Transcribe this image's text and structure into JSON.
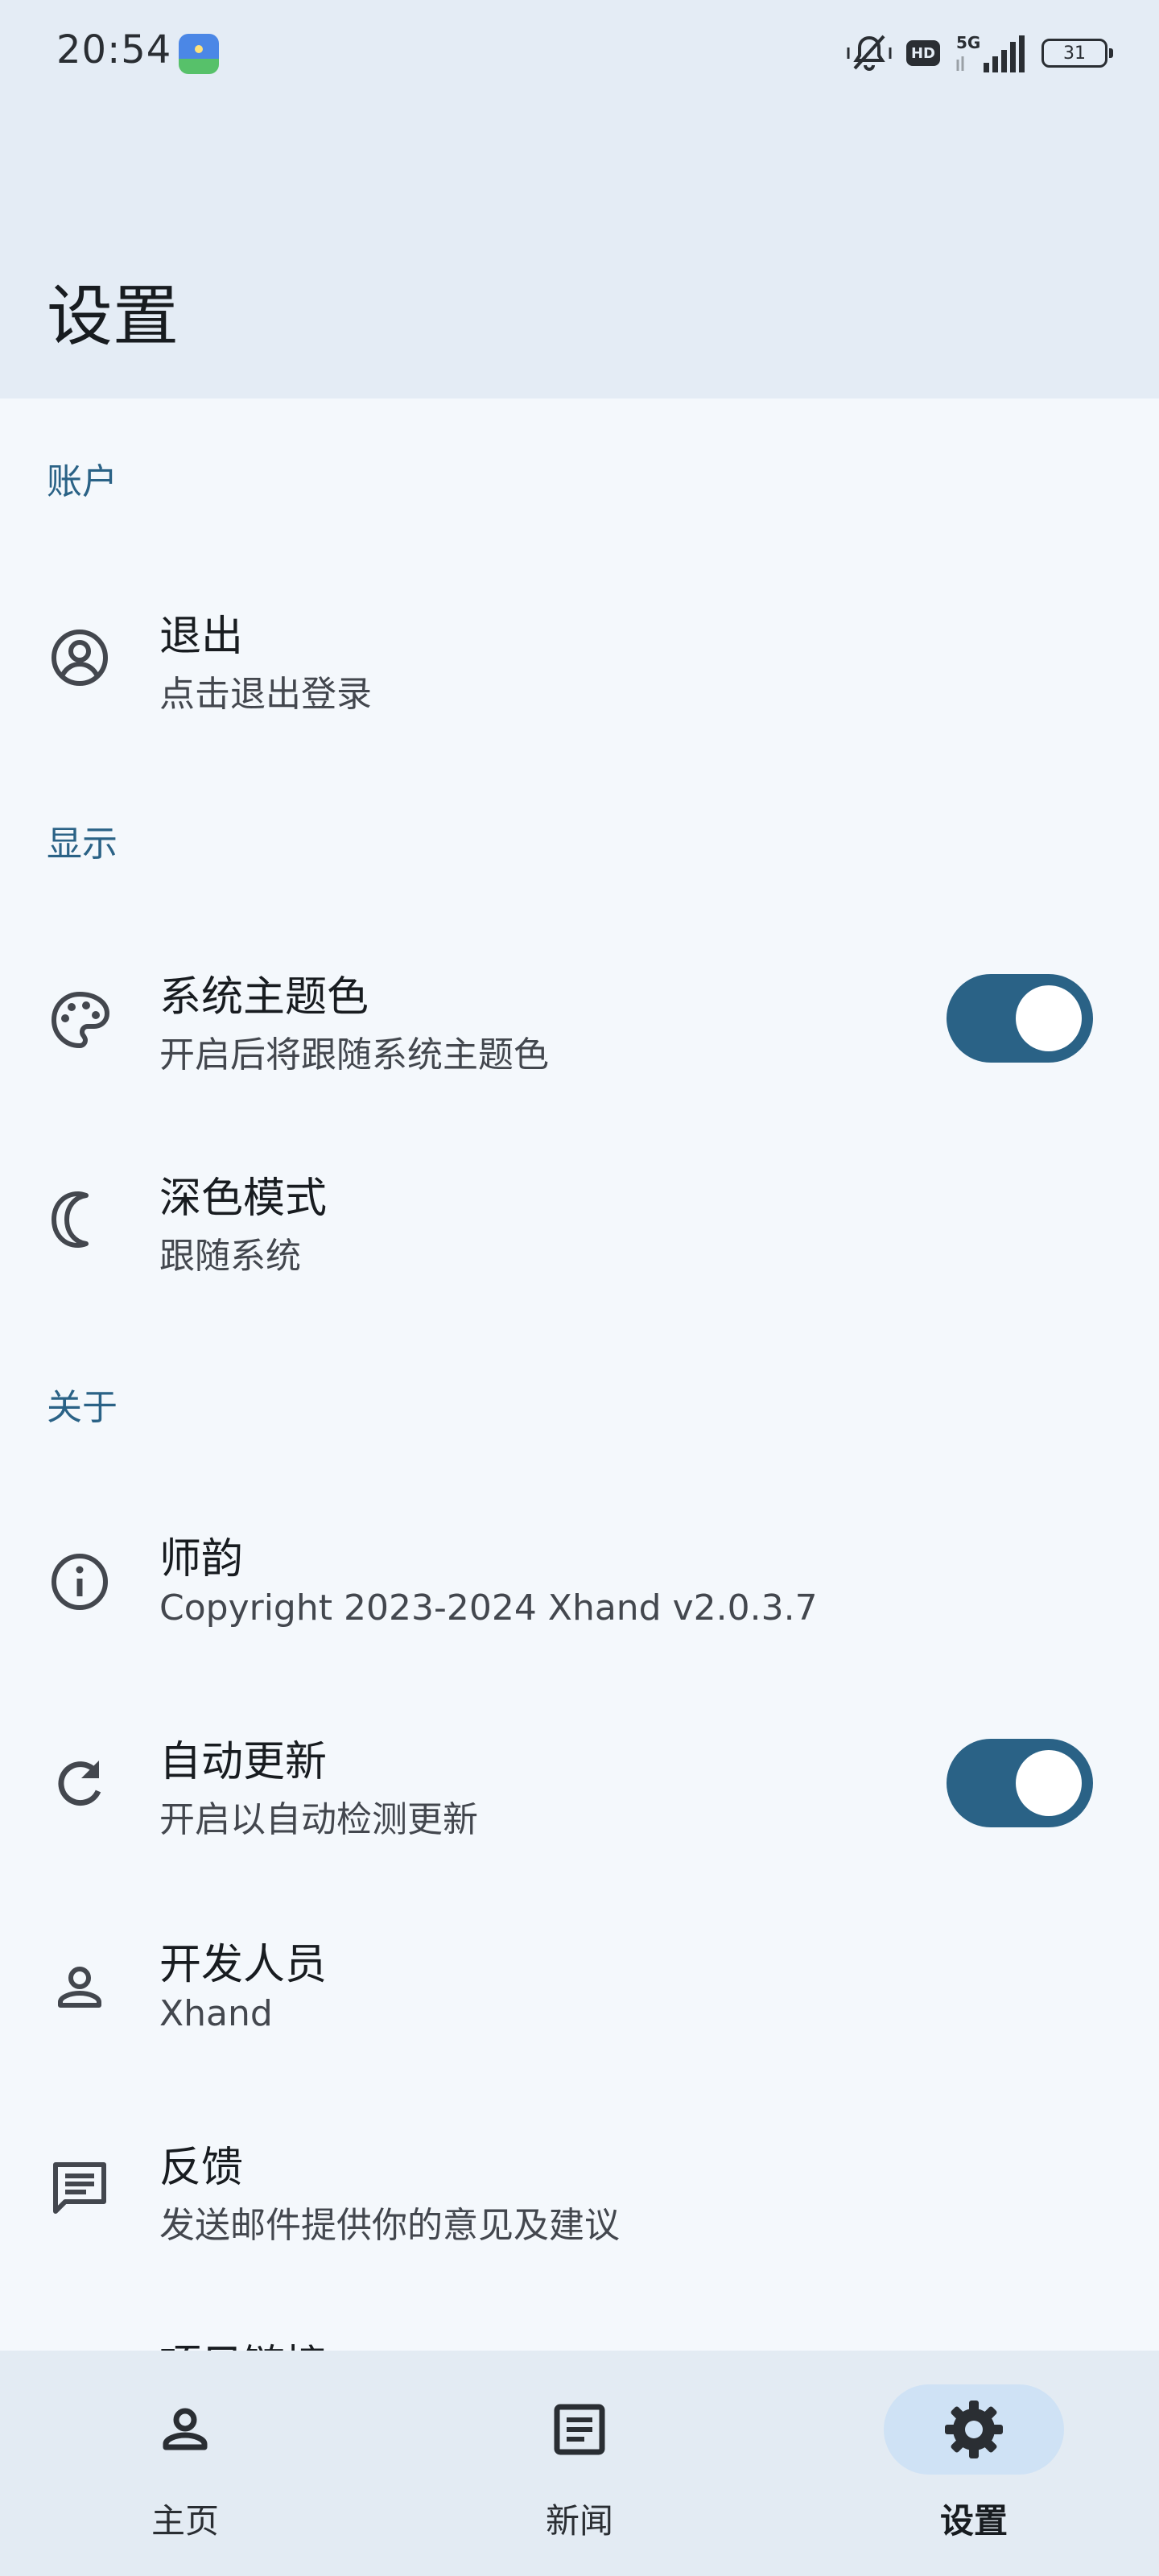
{
  "status_bar": {
    "time": "20:54",
    "hd_label": "HD",
    "network_label": "5G",
    "battery_level": "31"
  },
  "header": {
    "title": "设置"
  },
  "sections": {
    "account": "账户",
    "display": "显示",
    "about": "关于"
  },
  "rows": {
    "logout": {
      "title": "退出",
      "subtitle": "点击退出登录",
      "icon": "account-circle-icon"
    },
    "dynamic_color": {
      "title": "系统主题色",
      "subtitle": "开启后将跟随系统主题色",
      "icon": "palette-icon",
      "toggle_on": true
    },
    "dark_mode": {
      "title": "深色模式",
      "subtitle": "跟随系统",
      "icon": "moon-icon"
    },
    "app_info": {
      "title": "师韵",
      "subtitle": "Copyright 2023-2024 Xhand v2.0.3.7",
      "icon": "info-icon"
    },
    "auto_update": {
      "title": "自动更新",
      "subtitle": "开启以自动检测更新",
      "icon": "refresh-icon",
      "toggle_on": true
    },
    "developer": {
      "title": "开发人员",
      "subtitle": "Xhand",
      "icon": "person-icon"
    },
    "feedback": {
      "title": "反馈",
      "subtitle": "发送邮件提供你的意见及建议",
      "icon": "message-icon"
    },
    "project_link": {
      "title": "项目链接",
      "icon": "code-icon"
    }
  },
  "bottom_nav": {
    "items": [
      {
        "label": "主页",
        "icon": "person-icon",
        "active": false
      },
      {
        "label": "新闻",
        "icon": "article-icon",
        "active": false
      },
      {
        "label": "设置",
        "icon": "settings-gear-icon",
        "active": true
      }
    ]
  },
  "colors": {
    "accent": "#2A6286",
    "background": "#F4F8FC",
    "top_bar": "#E4ECF5",
    "nav_bar": "#E3EBF3",
    "active_pill": "#CFE2F5"
  }
}
